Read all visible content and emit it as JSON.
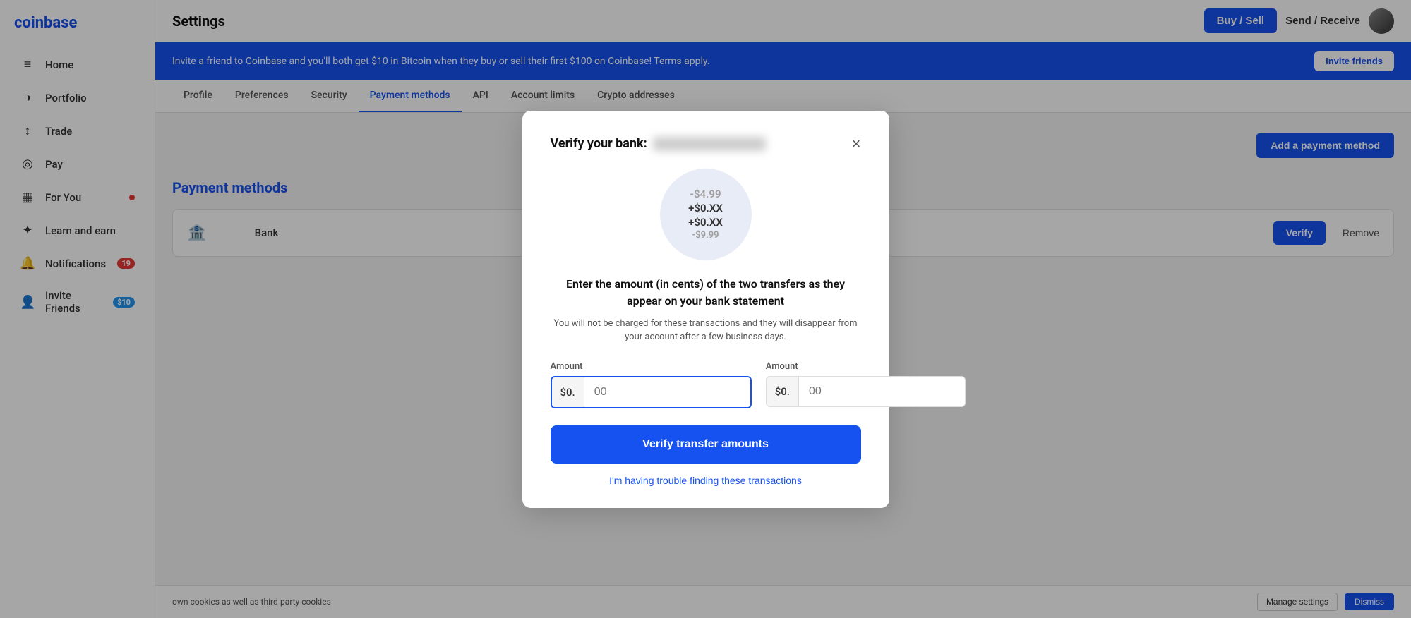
{
  "app": {
    "logo": "coinbase",
    "logo_display": "coinbase"
  },
  "topbar": {
    "title": "Settings",
    "buy_sell_label": "Buy / Sell",
    "send_receive_label": "Send / Receive"
  },
  "banner": {
    "text": "Invite a friend to Coinbase and you'll both get $10 in Bitcoin when they buy or sell their first $100 on Coinbase! Terms apply.",
    "invite_label": "Invite friends"
  },
  "sidebar": {
    "items": [
      {
        "id": "home",
        "label": "Home",
        "icon": "≡"
      },
      {
        "id": "portfolio",
        "label": "Portfolio",
        "icon": "◑"
      },
      {
        "id": "trade",
        "label": "Trade",
        "icon": "↕"
      },
      {
        "id": "pay",
        "label": "Pay",
        "icon": "◎"
      },
      {
        "id": "for-you",
        "label": "For You",
        "icon": "▦",
        "badge": "dot"
      },
      {
        "id": "learn-earn",
        "label": "Learn and earn",
        "icon": "✦"
      },
      {
        "id": "notifications",
        "label": "Notifications",
        "icon": "🔔",
        "badge": "19"
      },
      {
        "id": "invite-friends",
        "label": "Invite Friends",
        "icon": "👤",
        "badge": "$10",
        "badge_type": "blue"
      }
    ]
  },
  "settings_tabs": [
    {
      "id": "profile",
      "label": "Profile",
      "active": false
    },
    {
      "id": "preferences",
      "label": "Preferences",
      "active": false
    },
    {
      "id": "security",
      "label": "Security",
      "active": false
    },
    {
      "id": "payment-methods",
      "label": "Payment methods",
      "active": true
    },
    {
      "id": "api",
      "label": "API",
      "active": false
    },
    {
      "id": "account-limits",
      "label": "Account limits",
      "active": false
    },
    {
      "id": "crypto-addresses",
      "label": "Crypto addresses",
      "active": false
    }
  ],
  "payment_methods": {
    "section_title": "Payment methods",
    "add_payment_label": "Add a payment method",
    "bank_name_placeholder": "Bank",
    "verify_label": "Verify",
    "remove_label": "Remove"
  },
  "cookie_bar": {
    "text": "own cookies as well as third-party cookies",
    "manage_label": "Manage settings",
    "dismiss_label": "Dismiss"
  },
  "modal": {
    "title_prefix": "Verify your bank:",
    "title_bank_blurred": true,
    "close_icon": "×",
    "circle_amounts": [
      {
        "value": "-$4.99",
        "type": "negative"
      },
      {
        "value": "+$0.XX",
        "type": "positive"
      },
      {
        "value": "+$0.XX",
        "type": "positive"
      },
      {
        "value": "-$9.99",
        "type": "negative"
      }
    ],
    "instruction": "Enter the amount (in cents) of the two transfers as they appear on your bank statement",
    "note": "You will not be charged for these transactions and they will disappear from your account after a few business days.",
    "amount1": {
      "label": "Amount",
      "prefix": "$0.",
      "placeholder": "00",
      "value": ""
    },
    "amount2": {
      "label": "Amount",
      "prefix": "$0.",
      "placeholder": "00",
      "value": ""
    },
    "verify_btn_label": "Verify transfer amounts",
    "trouble_link": "I'm having trouble finding these transactions"
  }
}
